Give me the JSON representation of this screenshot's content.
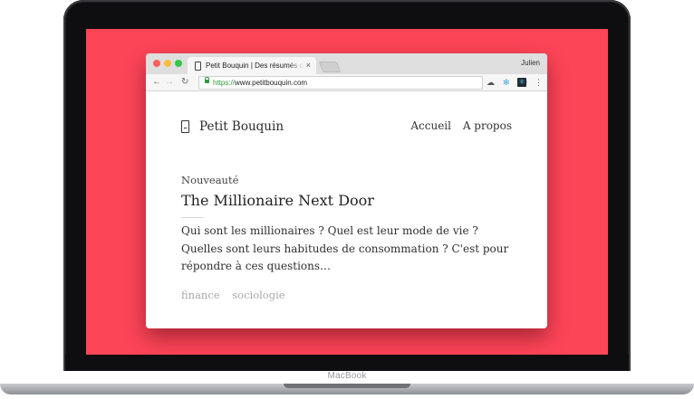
{
  "device": {
    "brand_label": "MacBook",
    "screen_color": "#fd4558"
  },
  "browser": {
    "tab": {
      "title": "Petit Bouquin | Des résumés de livres",
      "close": "×"
    },
    "profile_name": "Julien",
    "toolbar": {
      "back": "←",
      "forward": "→",
      "reload": "↻",
      "url_scheme": "https://",
      "url_host": "www.petitbouquin.com",
      "star": "☆",
      "menu": "⋮"
    },
    "extensions": [
      "cloud-icon",
      "gear-icon",
      "react-devtools-icon"
    ]
  },
  "page": {
    "brand_name": "Petit Bouquin",
    "nav": [
      {
        "label": "Accueil"
      },
      {
        "label": "A propos"
      }
    ],
    "post": {
      "kicker": "Nouveauté",
      "title": "The Millionaire Next Door",
      "excerpt": "Qui sont les millionaires ? Quel est leur mode de vie ? Quelles sont leurs habitudes de consommation ? C'est pour répondre à ces questions…",
      "tags": [
        "finance",
        "sociologie"
      ]
    }
  }
}
